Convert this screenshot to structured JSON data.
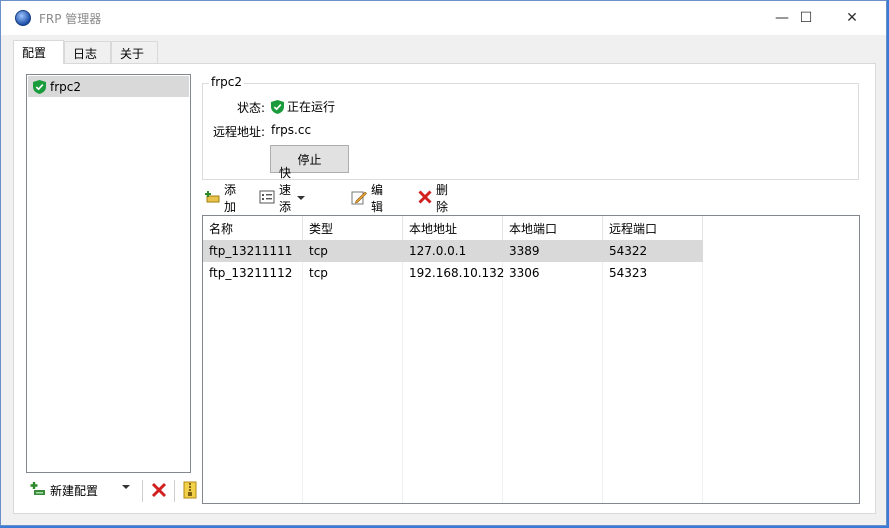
{
  "window": {
    "title": "FRP 管理器",
    "minimize": "—",
    "maximize": "☐",
    "close": "✕"
  },
  "tabs": [
    {
      "label": "配置",
      "active": true
    },
    {
      "label": "日志",
      "active": false
    },
    {
      "label": "关于",
      "active": false
    }
  ],
  "config_list": {
    "items": [
      {
        "name": "frpc2",
        "status": "running",
        "selected": true
      }
    ]
  },
  "bottom_toolbar": {
    "new_label": "新建配置"
  },
  "detail": {
    "group_title": "frpc2",
    "status_label": "状态:",
    "status_value": "正在运行",
    "remote_label": "远程地址:",
    "remote_value": "frps.cc",
    "stop_label": "停止"
  },
  "proxy_toolbar": {
    "add": "添加",
    "quick_add": "快速添加",
    "edit": "编辑",
    "delete": "删除"
  },
  "proxy_table": {
    "columns": [
      "名称",
      "类型",
      "本地地址",
      "本地端口",
      "远程端口"
    ],
    "rows": [
      {
        "name": "ftp_13211111",
        "type": "tcp",
        "local_addr": "127.0.0.1",
        "local_port": "3389",
        "remote_port": "54322",
        "selected": true
      },
      {
        "name": "ftp_13211112",
        "type": "tcp",
        "local_addr": "192.168.10.132",
        "local_port": "3306",
        "remote_port": "54323",
        "selected": false
      }
    ]
  },
  "colors": {
    "running": "#1a9b3c",
    "delete_red": "#d22020",
    "accent": "#3a7bd5"
  }
}
